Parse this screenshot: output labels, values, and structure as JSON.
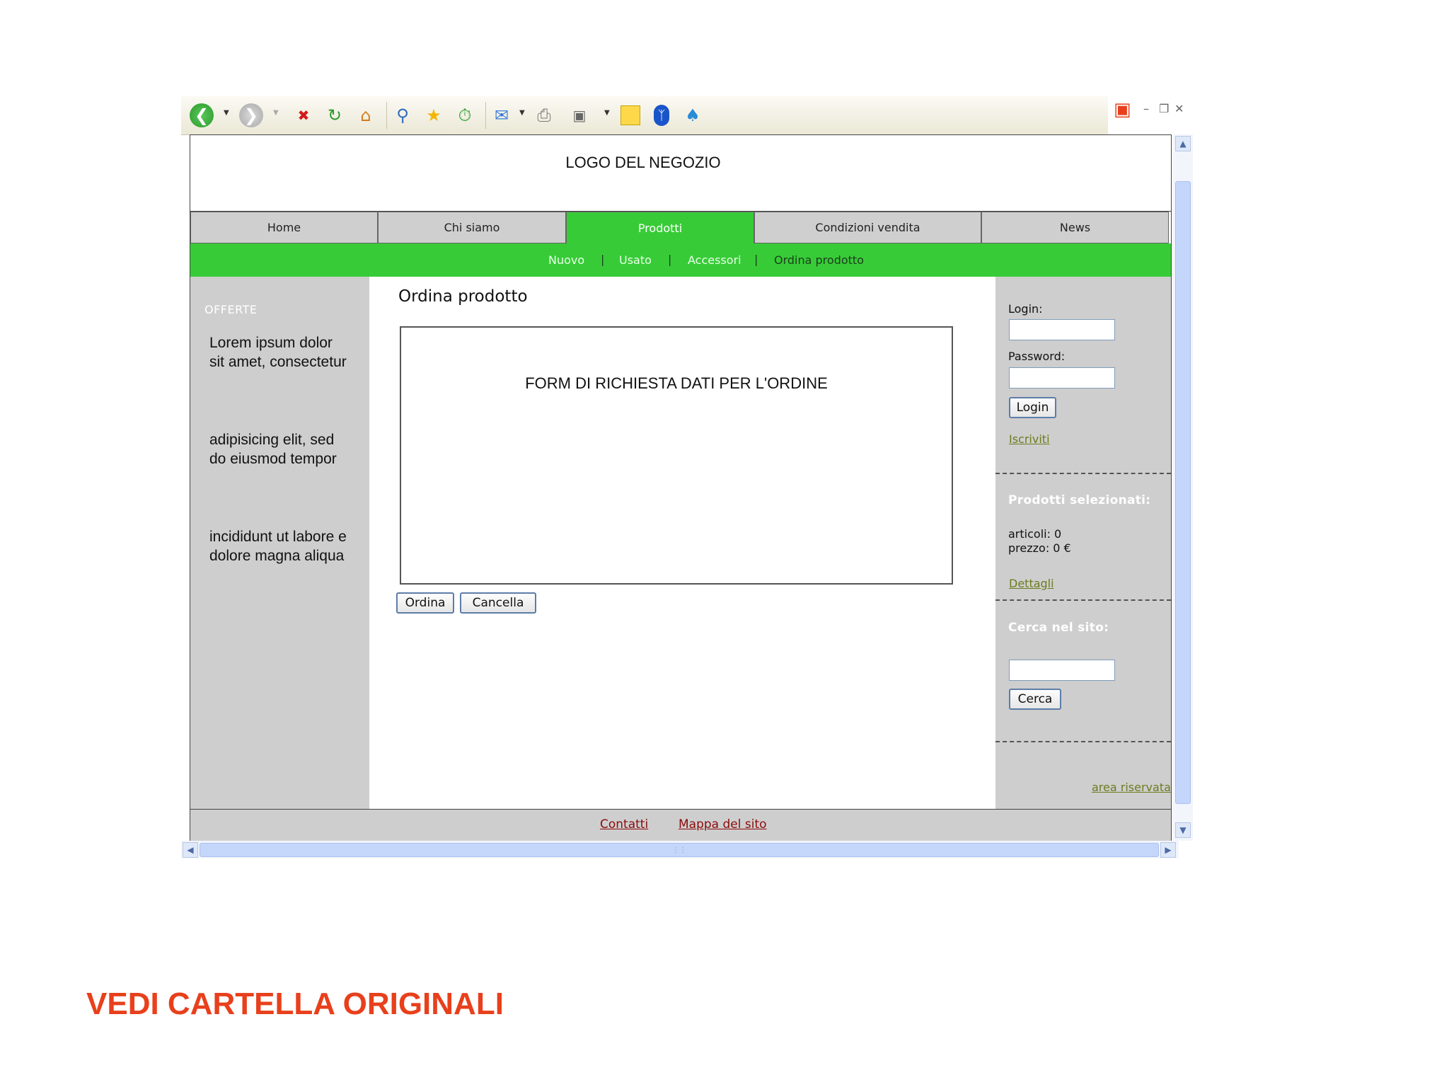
{
  "header": {
    "logo_text": "LOGO DEL NEGOZIO"
  },
  "nav": {
    "tabs": [
      {
        "label": "Home"
      },
      {
        "label": "Chi siamo"
      },
      {
        "label": "Prodotti"
      },
      {
        "label": "Condizioni vendita"
      },
      {
        "label": "News"
      }
    ],
    "active": "Prodotti"
  },
  "subnav": {
    "items": [
      {
        "label": "Nuovo"
      },
      {
        "label": "Usato"
      },
      {
        "label": "Accessori"
      },
      {
        "label": "Ordina prodotto"
      }
    ],
    "separator": "|",
    "current": "Ordina prodotto"
  },
  "left": {
    "title": "OFFERTE",
    "offers": [
      "Lorem ipsum dolor sit amet, consectetur",
      "adipisicing elit, sed do eiusmod tempor",
      "incididunt ut labore e dolore magna aliqua"
    ]
  },
  "main": {
    "title": "Ordina prodotto",
    "form_text": "FORM DI RICHIESTA DATI PER L'ORDINE",
    "order_button": "Ordina",
    "cancel_button": "Cancella"
  },
  "right": {
    "login_label": "Login:",
    "login_value": "",
    "password_label": "Password:",
    "password_value": "",
    "login_button": "Login",
    "signup_link": "Iscriviti",
    "selected_title": "Prodotti selezionati:",
    "articles": "articoli: 0",
    "price": "prezzo: 0 €",
    "details_link": "Dettagli",
    "search_title": "Cerca nel sito:",
    "search_value": "",
    "search_button": "Cerca",
    "reserved_link": "area riservata"
  },
  "footer": {
    "contacts": "Contatti",
    "sitemap": "Mappa del sito"
  },
  "caption": "VEDI CARTELLA ORIGINALI",
  "colors": {
    "accent_green": "#37cc37",
    "panel_gray": "#cecece",
    "caption_orange": "#e8401c",
    "footer_link": "#8b0b0b",
    "side_link": "#6b7d1f"
  },
  "icons": {
    "toolbar": [
      "back-icon",
      "forward-icon",
      "stop-icon",
      "refresh-icon",
      "home-icon",
      "search-icon",
      "favorites-icon",
      "history-icon",
      "mail-icon",
      "print-icon",
      "tools-icon",
      "notes-icon",
      "bluetooth-icon",
      "messenger-icon"
    ],
    "window": [
      "windows-logo-icon",
      "minimize-icon",
      "restore-icon",
      "close-icon"
    ]
  }
}
